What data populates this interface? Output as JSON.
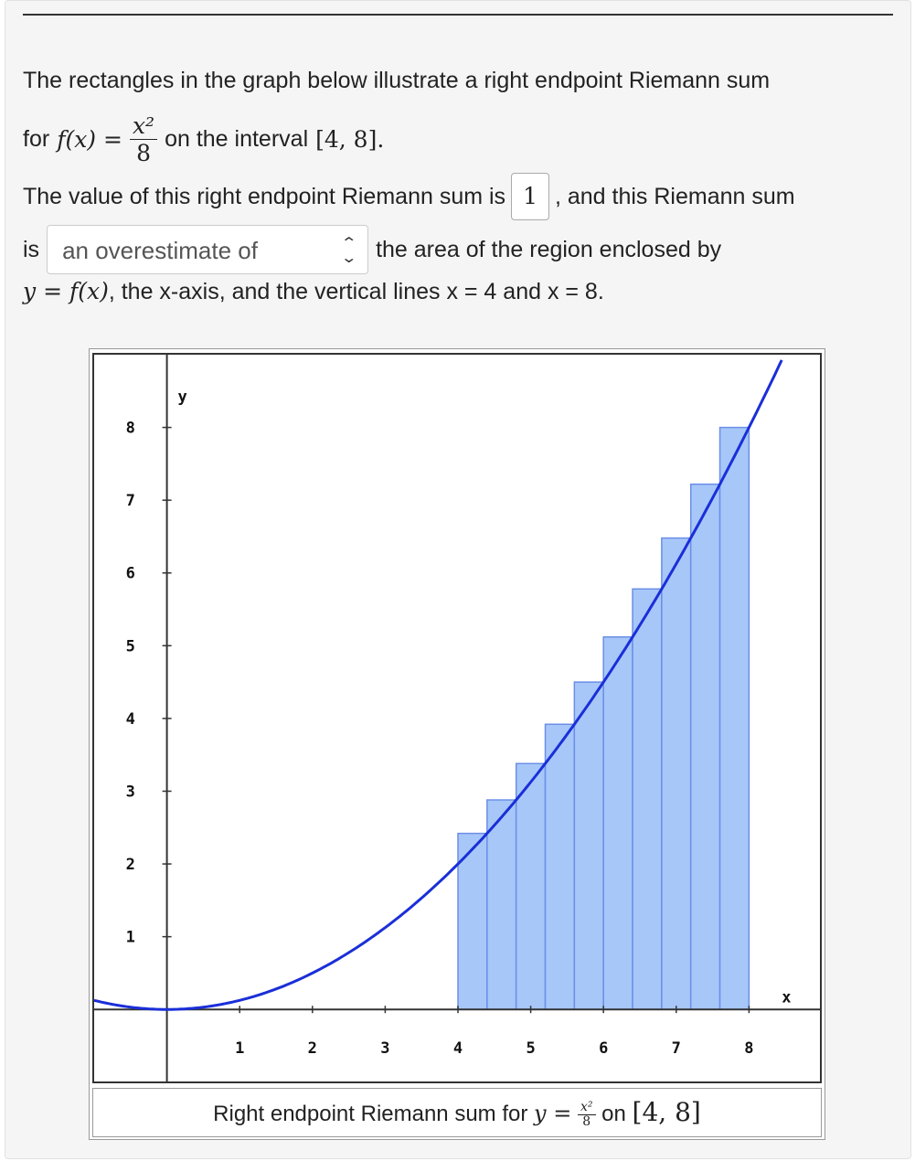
{
  "question": {
    "line1": "The rectangles in the graph below illustrate a right endpoint Riemann sum",
    "for_label": "for",
    "function_lhs": "f(x) =",
    "fraction_num": "x²",
    "fraction_den": "8",
    "on_interval": "on the interval",
    "interval": "[4, 8].",
    "line3_pre": "The value of this right endpoint Riemann sum is",
    "answer_value": "1",
    "line3_post": ", and this Riemann sum",
    "line4_pre": "is",
    "select_value": "an overestimate of",
    "line4_post": "the area of the region enclosed by",
    "line5_math": "y = f(x)",
    "line5_text": ", the x-axis, and the vertical lines x = 4 and x = 8."
  },
  "graph": {
    "caption_pre": "Right endpoint Riemann sum for",
    "caption_math": "y =",
    "caption_num": "x²",
    "caption_den": "8",
    "caption_on": "on",
    "caption_interval": "[4, 8]"
  },
  "chart_data": {
    "type": "bar",
    "function": "x^2/8",
    "interval": [
      4,
      8
    ],
    "rectangles": 10,
    "right_endpoints": [
      4.4,
      4.8,
      5.2,
      5.6,
      6.0,
      6.4,
      6.8,
      7.2,
      7.6,
      8.0
    ],
    "heights": [
      2.42,
      2.88,
      3.38,
      3.92,
      4.5,
      5.12,
      5.78,
      6.48,
      7.22,
      8.0
    ],
    "xlabel": "x",
    "ylabel": "y",
    "x_ticks": [
      "1",
      "2",
      "3",
      "4",
      "5",
      "6",
      "7",
      "8"
    ],
    "y_ticks": [
      "1",
      "2",
      "3",
      "4",
      "5",
      "6",
      "7",
      "8"
    ],
    "xlim": [
      -1,
      8.975
    ],
    "ylim": [
      -0.99,
      9
    ],
    "colors": {
      "rect_fill": "#a7c7f9",
      "rect_stroke": "#6b8fe6",
      "curve": "#1a2fd8"
    }
  }
}
